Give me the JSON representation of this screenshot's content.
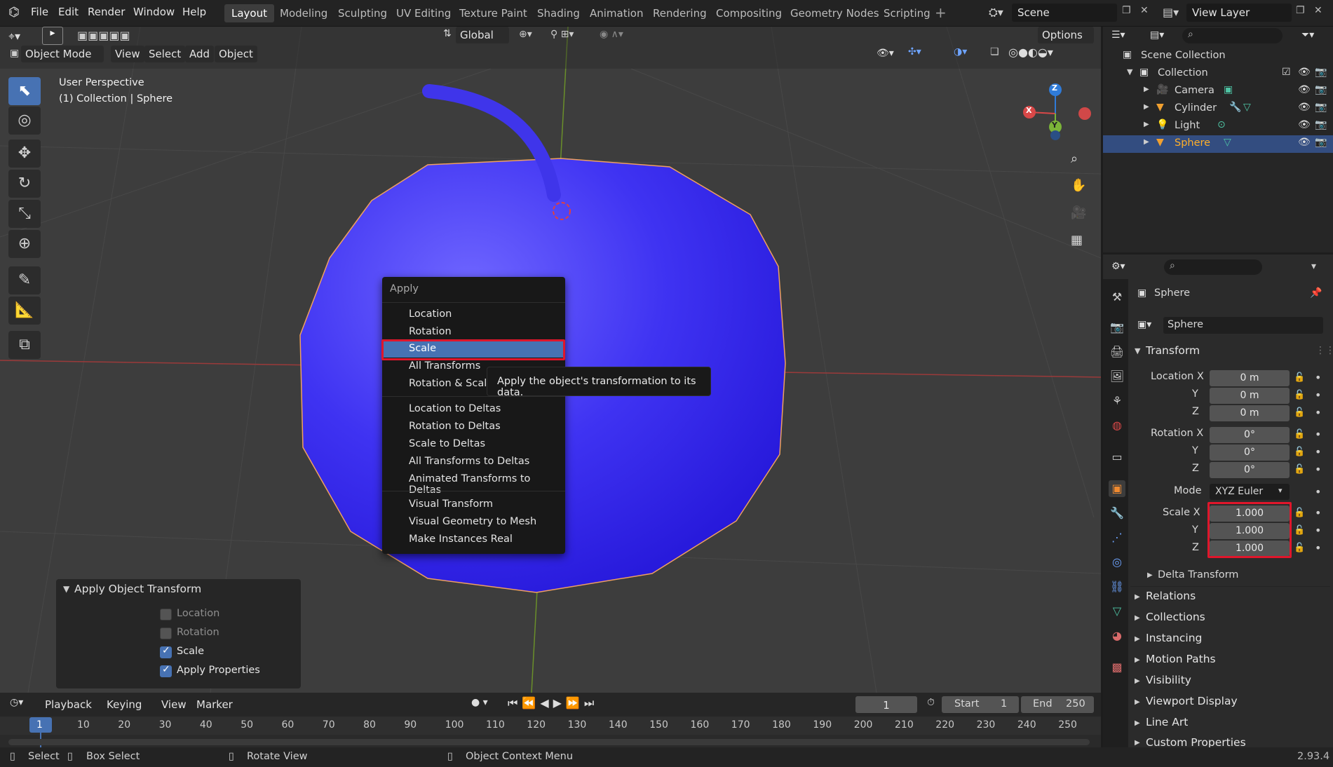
{
  "topbar": {
    "menus": [
      "File",
      "Edit",
      "Render",
      "Window",
      "Help"
    ],
    "workspaces": [
      "Layout",
      "Modeling",
      "Sculpting",
      "UV Editing",
      "Texture Paint",
      "Shading",
      "Animation",
      "Rendering",
      "Compositing",
      "Geometry Nodes",
      "Scripting"
    ],
    "active_workspace": "Layout",
    "scene": "Scene",
    "view_layer": "View Layer"
  },
  "vp_header": {
    "mode": "Object Mode",
    "menus": [
      "View",
      "Select",
      "Add",
      "Object"
    ],
    "orientation": "Global",
    "options": "Options"
  },
  "viewport": {
    "perspective": "User Perspective",
    "collection_info": "(1) Collection | Sphere",
    "gizmo": {
      "x": "X",
      "y": "Y",
      "z": "Z"
    }
  },
  "apply_menu": {
    "title": "Apply",
    "items_a": [
      "Location",
      "Rotation",
      "Scale",
      "All Transforms",
      "Rotation & Scale"
    ],
    "items_b": [
      "Location to Deltas",
      "Rotation to Deltas",
      "Scale to Deltas",
      "All Transforms to Deltas",
      "Animated Transforms to Deltas"
    ],
    "items_c": [
      "Visual Transform",
      "Visual Geometry to Mesh",
      "Make Instances Real"
    ],
    "highlighted": "Scale",
    "tooltip": "Apply the object's transformation to its data."
  },
  "redo_panel": {
    "title": "Apply Object Transform",
    "options": [
      {
        "label": "Location",
        "checked": false
      },
      {
        "label": "Rotation",
        "checked": false
      },
      {
        "label": "Scale",
        "checked": true
      },
      {
        "label": "Apply Properties",
        "checked": true
      }
    ]
  },
  "timeline": {
    "menus": [
      "Playback",
      "Keying",
      "View",
      "Marker"
    ],
    "current_frame": "1",
    "start_label": "Start",
    "start": "1",
    "end_label": "End",
    "end": "250",
    "ticks": [
      "1",
      "10",
      "20",
      "30",
      "40",
      "50",
      "60",
      "70",
      "80",
      "90",
      "100",
      "110",
      "120",
      "130",
      "140",
      "150",
      "160",
      "170",
      "180",
      "190",
      "200",
      "210",
      "220",
      "230",
      "240",
      "250"
    ]
  },
  "statusbar": {
    "select": "Select",
    "box_select": "Box Select",
    "rotate_view": "Rotate View",
    "context_menu": "Object Context Menu",
    "version": "2.93.4"
  },
  "outliner": {
    "root": "Scene Collection",
    "collection": "Collection",
    "objects": [
      "Camera",
      "Cylinder",
      "Light",
      "Sphere"
    ],
    "selected": "Sphere"
  },
  "properties": {
    "object_name": "Sphere",
    "data_name": "Sphere",
    "transform_label": "Transform",
    "location_label": "Location X",
    "location": [
      "0 m",
      "0 m",
      "0 m"
    ],
    "rotation_label": "Rotation X",
    "rotation": [
      "0°",
      "0°",
      "0°"
    ],
    "mode_label": "Mode",
    "mode": "XYZ Euler",
    "scale_label": "Scale X",
    "scale": [
      "1.000",
      "1.000",
      "1.000"
    ],
    "y_label": "Y",
    "z_label": "Z",
    "delta": "Delta Transform",
    "sections": [
      "Relations",
      "Collections",
      "Instancing",
      "Motion Paths",
      "Visibility",
      "Viewport Display",
      "Line Art",
      "Custom Properties"
    ]
  },
  "colors": {
    "accent": "#4772b3",
    "highlight_box": "#e0162b",
    "sphere": "#3b2ef0",
    "selected_text": "#ffaf29"
  }
}
